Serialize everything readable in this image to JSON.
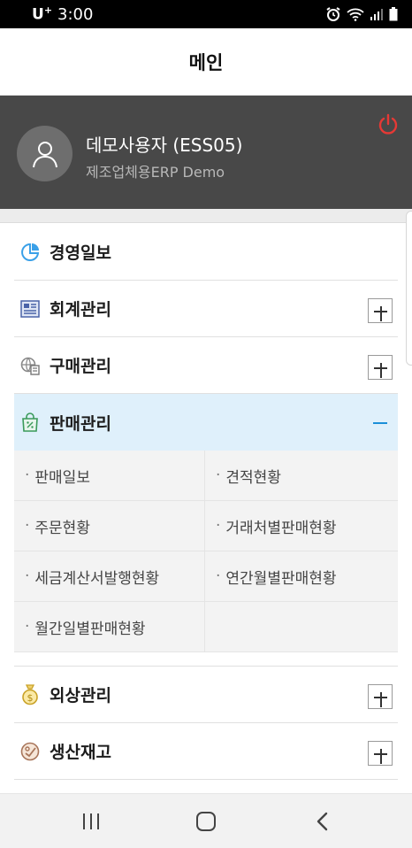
{
  "status_bar": {
    "carrier": "U",
    "carrier_sup": "+",
    "time": "3:00",
    "icons": [
      "alarm-icon",
      "wifi-icon",
      "signal-icon",
      "battery-icon"
    ]
  },
  "app_bar": {
    "title": "메인"
  },
  "profile": {
    "user_name": "데모사용자 (ESS05)",
    "company": "제조업체용ERP Demo",
    "avatar_icon": "user-icon",
    "logout_icon": "power-icon"
  },
  "menu": {
    "items": [
      {
        "label": "경영일보",
        "icon": "pie-chart-icon",
        "expandable": false
      },
      {
        "label": "회계관리",
        "icon": "ledger-icon",
        "expandable": true
      },
      {
        "label": "구매관리",
        "icon": "purchase-icon",
        "expandable": true
      },
      {
        "label": "판매관리",
        "icon": "shopping-bag-icon",
        "expanded": true
      },
      {
        "label": "외상관리",
        "icon": "money-bag-icon",
        "expandable": true
      },
      {
        "label": "생산재고",
        "icon": "production-icon",
        "expandable": true
      }
    ],
    "sales_submenu": [
      "판매일보",
      "견적현황",
      "주문현황",
      "거래처별판매현황",
      "세금계산서발행현황",
      "연간월별판매현황",
      "월간일별판매현황"
    ],
    "bullet": "·"
  },
  "colors": {
    "profile_bg": "#484848",
    "active_bg": "#dff0fb",
    "accent": "#1a8fd8",
    "power": "#e53935"
  }
}
